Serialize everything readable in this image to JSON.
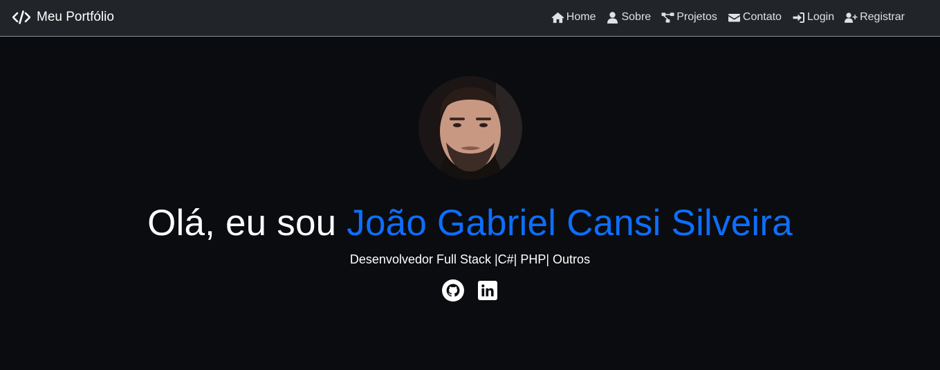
{
  "navbar": {
    "brand_icon": "code-icon",
    "brand_label": "Meu Portfólio",
    "items": [
      {
        "icon": "home-icon",
        "label": "Home"
      },
      {
        "icon": "user-icon",
        "label": "Sobre"
      },
      {
        "icon": "project-diagram-icon",
        "label": "Projetos"
      },
      {
        "icon": "envelope-icon",
        "label": "Contato"
      },
      {
        "icon": "sign-in-icon",
        "label": "Login"
      },
      {
        "icon": "user-plus-icon",
        "label": "Registrar"
      }
    ]
  },
  "hero": {
    "greeting": "Olá, eu sou ",
    "name": "João Gabriel Cansi Silveira",
    "subtitle": "Desenvolvedor Full Stack |C#| PHP| Outros",
    "socials": [
      {
        "icon": "github-icon"
      },
      {
        "icon": "linkedin-icon"
      }
    ]
  },
  "colors": {
    "background": "#0b0c0f",
    "navbar": "#212529",
    "accent": "#0d6efd",
    "text": "#ffffff"
  }
}
